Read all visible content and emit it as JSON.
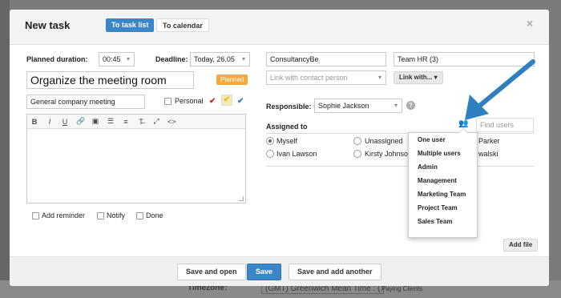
{
  "background": {
    "timezone_label": "Timezone:",
    "timezone_value": "(GMT) Greenwich Mean Time : (",
    "fragment_ts": "ts",
    "fragment_pa": "Paying Clients"
  },
  "modal": {
    "title": "New task",
    "tabs": [
      {
        "label": "To task list",
        "active": true
      },
      {
        "label": "To calendar",
        "active": false
      }
    ],
    "close": "×"
  },
  "form": {
    "planned_duration_label": "Planned duration:",
    "planned_duration_value": "00:45",
    "deadline_label": "Deadline:",
    "deadline_value": "Today, 26.05",
    "task_title": "Organize the meeting room",
    "status_badge": "Planned",
    "category_value": "General company meeting",
    "personal_label": "Personal",
    "company_value": "ConsultancyBe",
    "project_value": "Team HR (3)",
    "contact_placeholder": "Link with contact person",
    "link_with_label": "Link with...",
    "responsible_label": "Responsible:",
    "responsible_value": "Sophie Jackson",
    "help": "?",
    "assigned_to_label": "Assigned to",
    "find_users_placeholder": "Find users",
    "assignees": [
      {
        "label": "Myself",
        "selected": true
      },
      {
        "label": "Unassigned",
        "selected": false
      },
      {
        "label": "Parker",
        "selected": false
      },
      {
        "label": "Ivan Lawson",
        "selected": false
      },
      {
        "label": "Kirsty Johnson",
        "selected": false
      },
      {
        "label": "walski",
        "selected": false
      }
    ],
    "checkboxes": {
      "add_reminder": "Add reminder",
      "notify": "Notify",
      "done": "Done"
    },
    "add_file": "Add file"
  },
  "editor_toolbar": [
    "B",
    "I",
    "U",
    "link",
    "image",
    "bullets",
    "numbered",
    "clear-format",
    "fullscreen",
    "source"
  ],
  "user_dropdown": {
    "items": [
      "One user",
      "Multiple users",
      "Admin",
      "Management",
      "Marketing Team",
      "Project Team",
      "Sales Team"
    ]
  },
  "footer": {
    "save_and_open": "Save and open",
    "save": "Save",
    "save_and_add_another": "Save and add another"
  },
  "colors": {
    "primary": "#3b86c6",
    "badge": "#f3a93b",
    "arrow": "#2f7fc1"
  }
}
